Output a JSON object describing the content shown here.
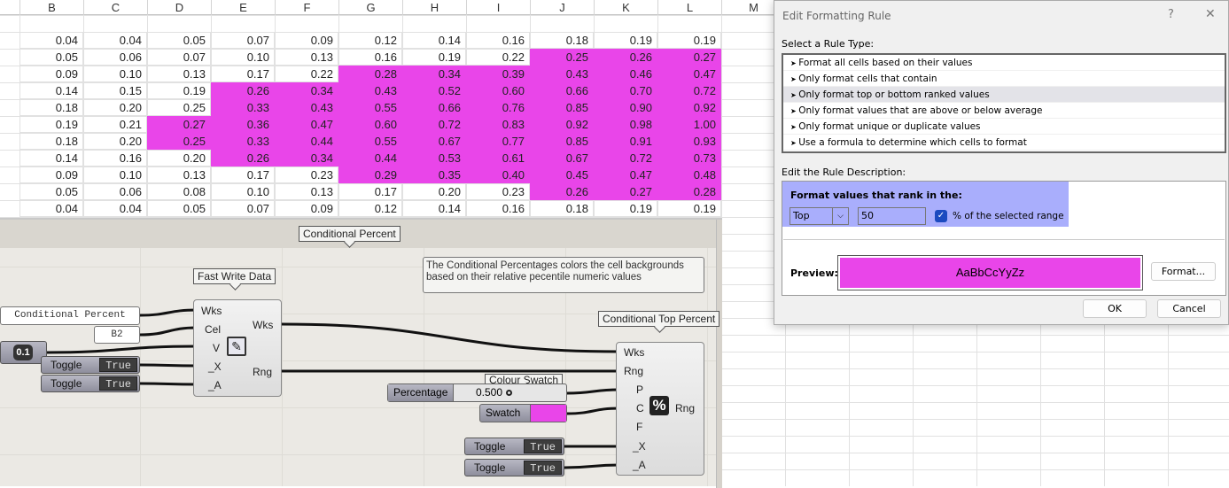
{
  "spreadsheet": {
    "columns": [
      "B",
      "C",
      "D",
      "E",
      "F",
      "G",
      "H",
      "I",
      "J",
      "K",
      "L",
      "M"
    ],
    "rows": [
      [
        "0.04",
        "0.04",
        "0.05",
        "0.07",
        "0.09",
        "0.12",
        "0.14",
        "0.16",
        "0.18",
        "0.19",
        "0.19"
      ],
      [
        "0.05",
        "0.06",
        "0.07",
        "0.10",
        "0.13",
        "0.16",
        "0.19",
        "0.22",
        "0.25",
        "0.26",
        "0.27"
      ],
      [
        "0.09",
        "0.10",
        "0.13",
        "0.17",
        "0.22",
        "0.28",
        "0.34",
        "0.39",
        "0.43",
        "0.46",
        "0.47"
      ],
      [
        "0.14",
        "0.15",
        "0.19",
        "0.26",
        "0.34",
        "0.43",
        "0.52",
        "0.60",
        "0.66",
        "0.70",
        "0.72"
      ],
      [
        "0.18",
        "0.20",
        "0.25",
        "0.33",
        "0.43",
        "0.55",
        "0.66",
        "0.76",
        "0.85",
        "0.90",
        "0.92"
      ],
      [
        "0.19",
        "0.21",
        "0.27",
        "0.36",
        "0.47",
        "0.60",
        "0.72",
        "0.83",
        "0.92",
        "0.98",
        "1.00"
      ],
      [
        "0.18",
        "0.20",
        "0.25",
        "0.33",
        "0.44",
        "0.55",
        "0.67",
        "0.77",
        "0.85",
        "0.91",
        "0.93"
      ],
      [
        "0.14",
        "0.16",
        "0.20",
        "0.26",
        "0.34",
        "0.44",
        "0.53",
        "0.61",
        "0.67",
        "0.72",
        "0.73"
      ],
      [
        "0.09",
        "0.10",
        "0.13",
        "0.17",
        "0.23",
        "0.29",
        "0.35",
        "0.40",
        "0.45",
        "0.47",
        "0.48"
      ],
      [
        "0.05",
        "0.06",
        "0.08",
        "0.10",
        "0.13",
        "0.17",
        "0.20",
        "0.23",
        "0.26",
        "0.27",
        "0.28"
      ],
      [
        "0.04",
        "0.04",
        "0.05",
        "0.07",
        "0.09",
        "0.12",
        "0.14",
        "0.16",
        "0.18",
        "0.19",
        "0.19"
      ]
    ],
    "highlight_from_column": [
      null,
      "J",
      "G",
      "E",
      "E",
      "D",
      "D",
      "E",
      "G",
      "J",
      null
    ],
    "highlight_color": "#e945e9"
  },
  "canvas": {
    "group_label": "Conditional Percent",
    "note": "The Conditional Percentages colors the cell backgrounds based on their relative pecentile numeric values",
    "fast_write": {
      "label": "Fast Write Data",
      "inputs": [
        "Wks",
        "Cel",
        "V",
        "_X",
        "_A"
      ],
      "outputs": [
        "Wks",
        "Rng"
      ]
    },
    "panel_wks": "Conditional Percent",
    "panel_cell": "B2",
    "number": "0.1",
    "toggles": [
      {
        "label": "Toggle",
        "value": "True"
      },
      {
        "label": "Toggle",
        "value": "True"
      },
      {
        "label": "Toggle",
        "value": "True"
      },
      {
        "label": "Toggle",
        "value": "True"
      }
    ],
    "top_percent": {
      "label": "Conditional Top Percent",
      "inputs": [
        "Wks",
        "Rng",
        "P",
        "C",
        "F",
        "_X",
        "_A"
      ],
      "output": "Rng"
    },
    "colour_swatch_label": "Colour Swatch",
    "percentage": {
      "label": "Percentage",
      "value": "0.500"
    },
    "swatch": {
      "label": "Swatch",
      "color": "#e945e9"
    }
  },
  "dialog": {
    "title": "Edit Formatting Rule",
    "help": "?",
    "close": "✕",
    "select_label": "Select a Rule Type:",
    "rule_types": [
      "Format all cells based on their values",
      "Only format cells that contain",
      "Only format top or bottom ranked values",
      "Only format values that are above or below average",
      "Only format unique or duplicate values",
      "Use a formula to determine which cells to format"
    ],
    "selected_rule": 2,
    "edit_label": "Edit the Rule Description:",
    "rank_heading": "Format values that rank in the:",
    "rank_select": "Top",
    "rank_value": "50",
    "percent_checked": true,
    "percent_label": "% of the selected range",
    "preview_label": "Preview:",
    "preview_text": "AaBbCcYyZz",
    "preview_color": "#e945e9",
    "format_button": "Format...",
    "ok": "OK",
    "cancel": "Cancel"
  }
}
